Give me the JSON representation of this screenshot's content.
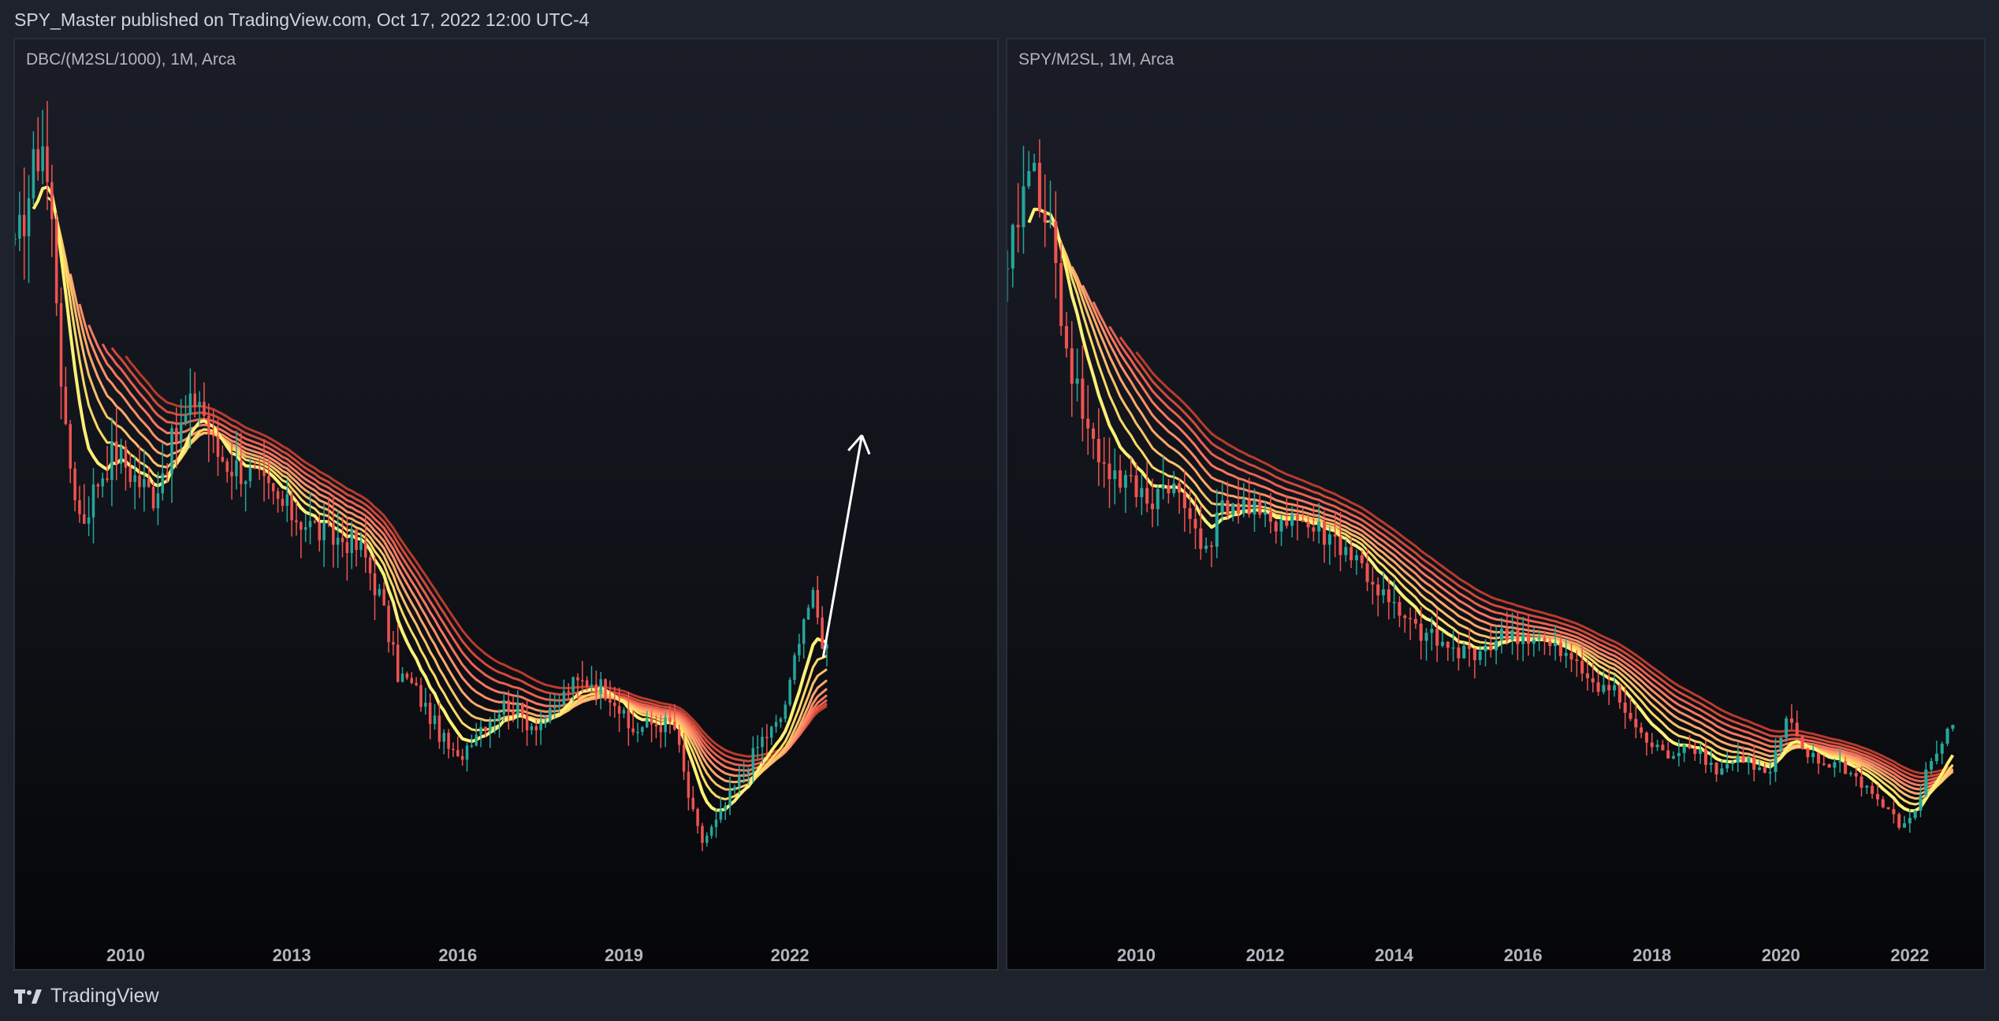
{
  "header": {
    "publish_line": "SPY_Master published on TradingView.com, Oct 17, 2022 12:00 UTC-4"
  },
  "footer": {
    "brand": "TradingView"
  },
  "colors": {
    "background": "#1e222d",
    "up_candle": "#26a69a",
    "down_candle": "#ef5350",
    "ribbon": [
      "#fff176",
      "#ffd966",
      "#ffc06b",
      "#ffa86b",
      "#ff8f66",
      "#f87760",
      "#e8614f",
      "#d04a3a",
      "#b83b2c"
    ],
    "arrow": "#ffffff"
  },
  "chart_data": [
    {
      "type": "candlestick",
      "title": "DBC/(M2SL/1000), 1M, Arca",
      "x_ticks": [
        "2010",
        "2013",
        "2016",
        "2019",
        "2022"
      ],
      "x_tick_years": [
        2010,
        2013,
        2016,
        2019,
        2022
      ],
      "x_range": [
        2008.0,
        2025.8
      ],
      "y_range": [
        0.8,
        6.3
      ],
      "ribbon_lines": 9,
      "annotation": "arrow-up",
      "annotation_from": [
        2022.6,
        2.5
      ],
      "annotation_to": [
        2023.3,
        4.0
      ],
      "close_series": [
        [
          2008.0,
          5.2
        ],
        [
          2008.4,
          5.9
        ],
        [
          2008.5,
          6.0
        ],
        [
          2008.7,
          5.3
        ],
        [
          2008.9,
          4.0
        ],
        [
          2009.2,
          3.4
        ],
        [
          2009.5,
          3.7
        ],
        [
          2009.8,
          3.9
        ],
        [
          2010.2,
          3.7
        ],
        [
          2010.5,
          3.6
        ],
        [
          2010.8,
          3.9
        ],
        [
          2011.2,
          4.2
        ],
        [
          2011.3,
          4.3
        ],
        [
          2011.6,
          3.9
        ],
        [
          2011.9,
          3.8
        ],
        [
          2012.2,
          3.75
        ],
        [
          2012.6,
          3.6
        ],
        [
          2012.9,
          3.5
        ],
        [
          2013.3,
          3.4
        ],
        [
          2013.7,
          3.3
        ],
        [
          2014.0,
          3.3
        ],
        [
          2014.3,
          3.2
        ],
        [
          2014.6,
          2.9
        ],
        [
          2014.9,
          2.4
        ],
        [
          2015.2,
          2.3
        ],
        [
          2015.5,
          2.1
        ],
        [
          2015.8,
          1.9
        ],
        [
          2016.0,
          1.8
        ],
        [
          2016.3,
          2.0
        ],
        [
          2016.6,
          2.1
        ],
        [
          2016.9,
          2.2
        ],
        [
          2017.3,
          2.05
        ],
        [
          2017.7,
          2.1
        ],
        [
          2018.0,
          2.3
        ],
        [
          2018.4,
          2.35
        ],
        [
          2018.8,
          2.25
        ],
        [
          2019.1,
          2.0
        ],
        [
          2019.5,
          2.05
        ],
        [
          2019.9,
          2.05
        ],
        [
          2020.2,
          1.5
        ],
        [
          2020.4,
          1.25
        ],
        [
          2020.7,
          1.4
        ],
        [
          2020.9,
          1.55
        ],
        [
          2021.2,
          1.75
        ],
        [
          2021.5,
          1.95
        ],
        [
          2021.8,
          2.05
        ],
        [
          2022.0,
          2.3
        ],
        [
          2022.2,
          2.75
        ],
        [
          2022.4,
          2.9
        ],
        [
          2022.6,
          2.6
        ],
        [
          2022.7,
          2.55
        ]
      ]
    },
    {
      "type": "candlestick",
      "title": "SPY/M2SL, 1M, Arca",
      "x_ticks": [
        "2010",
        "2012",
        "2014",
        "2016",
        "2018",
        "2020",
        "2022"
      ],
      "x_tick_years": [
        2010,
        2012,
        2014,
        2016,
        2018,
        2020,
        2022
      ],
      "x_range": [
        2008.0,
        2023.2
      ],
      "y_range": [
        0.5,
        6.1
      ],
      "ribbon_lines": 9,
      "close_series": [
        [
          2008.0,
          4.8
        ],
        [
          2008.2,
          5.4
        ],
        [
          2008.4,
          5.6
        ],
        [
          2008.6,
          5.3
        ],
        [
          2008.8,
          4.7
        ],
        [
          2009.0,
          4.2
        ],
        [
          2009.3,
          3.7
        ],
        [
          2009.6,
          3.5
        ],
        [
          2009.9,
          3.4
        ],
        [
          2010.2,
          3.3
        ],
        [
          2010.5,
          3.45
        ],
        [
          2010.8,
          3.2
        ],
        [
          2011.1,
          3.0
        ],
        [
          2011.4,
          3.3
        ],
        [
          2011.7,
          3.25
        ],
        [
          2012.0,
          3.15
        ],
        [
          2012.4,
          3.2
        ],
        [
          2012.8,
          3.1
        ],
        [
          2013.2,
          3.0
        ],
        [
          2013.5,
          2.85
        ],
        [
          2013.9,
          2.6
        ],
        [
          2014.2,
          2.45
        ],
        [
          2014.6,
          2.35
        ],
        [
          2015.0,
          2.25
        ],
        [
          2015.4,
          2.3
        ],
        [
          2015.8,
          2.4
        ],
        [
          2016.2,
          2.35
        ],
        [
          2016.6,
          2.25
        ],
        [
          2017.0,
          2.1
        ],
        [
          2017.4,
          2.0
        ],
        [
          2017.8,
          1.7
        ],
        [
          2018.2,
          1.55
        ],
        [
          2018.6,
          1.65
        ],
        [
          2019.0,
          1.45
        ],
        [
          2019.4,
          1.55
        ],
        [
          2019.8,
          1.4
        ],
        [
          2020.1,
          1.8
        ],
        [
          2020.3,
          1.6
        ],
        [
          2020.6,
          1.5
        ],
        [
          2020.9,
          1.5
        ],
        [
          2021.3,
          1.35
        ],
        [
          2021.6,
          1.2
        ],
        [
          2021.9,
          1.05
        ],
        [
          2022.1,
          1.2
        ],
        [
          2022.3,
          1.5
        ],
        [
          2022.5,
          1.65
        ],
        [
          2022.7,
          1.8
        ]
      ]
    }
  ]
}
